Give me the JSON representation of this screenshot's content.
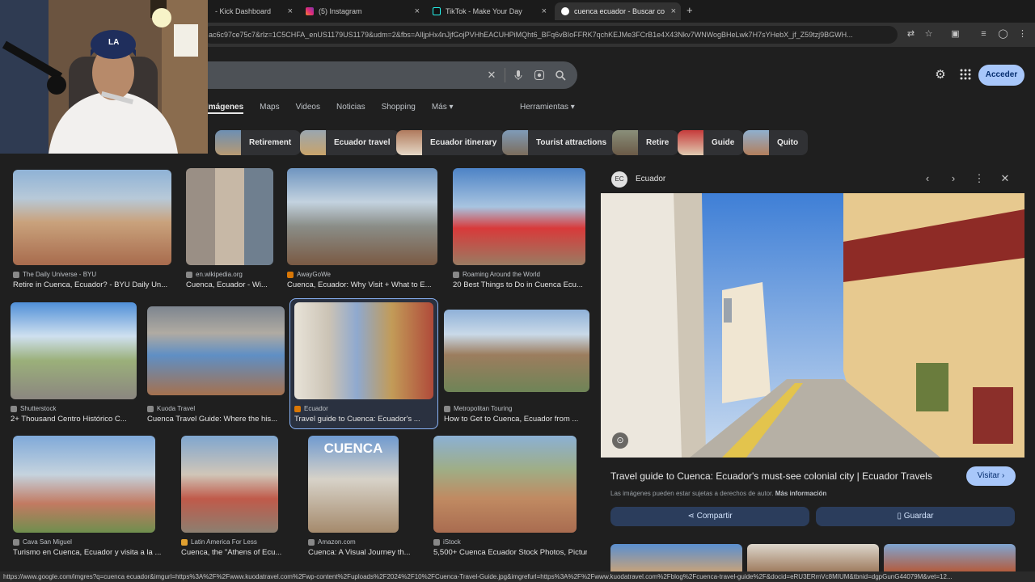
{
  "browser": {
    "tabs": [
      {
        "title": "- Kick Dashboard",
        "icon": "kick-icon"
      },
      {
        "title": "(5) Instagram",
        "icon": "instagram-icon"
      },
      {
        "title": "TikTok - Make Your Day",
        "icon": "tiktok-icon"
      },
      {
        "title": "cuenca ecuador - Buscar con",
        "icon": "google-icon",
        "active": true
      }
    ],
    "url": "ac6c97ce75c7&rlz=1C5CHFA_enUS1179US1179&udm=2&fbs=AIljpHx4nJjfGojPVHhEACUHPiMQht6_BFq6vBIoFFRK7qchKEJMe3FCrB1e4X43Nkv7WNWogBHeLwk7H7sYHebX_jf_Z59tzj9BGWH..."
  },
  "google": {
    "sign_in": "Acceder",
    "nav_tabs": [
      "Imágenes",
      "Maps",
      "Videos",
      "Noticias",
      "Shopping",
      "Más"
    ],
    "tools": "Herramientas",
    "chips": [
      "Retirement",
      "Ecuador travel",
      "Ecuador itinerary",
      "Tourist attractions",
      "Retire",
      "Guide",
      "Quito"
    ]
  },
  "results": [
    {
      "source": "The Daily Universe - BYU",
      "title": "Retire in Cuenca, Ecuador? - BYU Daily Un..."
    },
    {
      "source": "en.wikipedia.org",
      "title": "Cuenca, Ecuador - Wi..."
    },
    {
      "source": "AwayGoWe",
      "title": "Cuenca, Ecuador: Why Visit + What to E..."
    },
    {
      "source": "Roaming Around the World",
      "title": "20 Best Things to Do in Cuenca Ecu..."
    },
    {
      "source": "Shutterstock",
      "title": "2+ Thousand Centro Histórico C..."
    },
    {
      "source": "Kuoda Travel",
      "title": "Cuenca Travel Guide: Where the his..."
    },
    {
      "source": "Ecuador",
      "title": "Travel guide to Cuenca: Ecuador's ..."
    },
    {
      "source": "Metropolitan Touring",
      "title": "How to Get to Cuenca, Ecuador from ..."
    },
    {
      "source": "Cava San Miguel",
      "title": "Turismo en Cuenca, Ecuador y visita a la ..."
    },
    {
      "source": "Latin America For Less",
      "title": "Cuenca, the \"Athens of Ecu..."
    },
    {
      "source": "Amazon.com",
      "title": "Cuenca: A Visual Journey th..."
    },
    {
      "source": "iStock",
      "title": "5,500+ Cuenca Ecuador Stock Photos, Pictur..."
    }
  ],
  "result_overlay_text": "CUENCA",
  "panel": {
    "site": "Ecuador",
    "title": "Travel guide to Cuenca: Ecuador's must-see colonial city | Ecuador Travels",
    "visit": "Visitar",
    "copyright": "Las imágenes pueden estar sujetas a derechos de autor.",
    "more_info": "Más información",
    "share": "Compartir",
    "save": "Guardar"
  },
  "status_url": "https://www.google.com/imgres?q=cuenca ecuador&imgurl=https%3A%2F%2Fwww.kuodatravel.com%2Fwp-content%2Fuploads%2F2024%2F10%2FCuenca-Travel-Guide.jpg&imgrefurl=https%3A%2F%2Fwww.kuodatravel.com%2Fblog%2Fcuenca-travel-guide%2F&docid=eRU3ERmVc8MIUM&tbnid=dgpGunG44079M&vet=12..."
}
